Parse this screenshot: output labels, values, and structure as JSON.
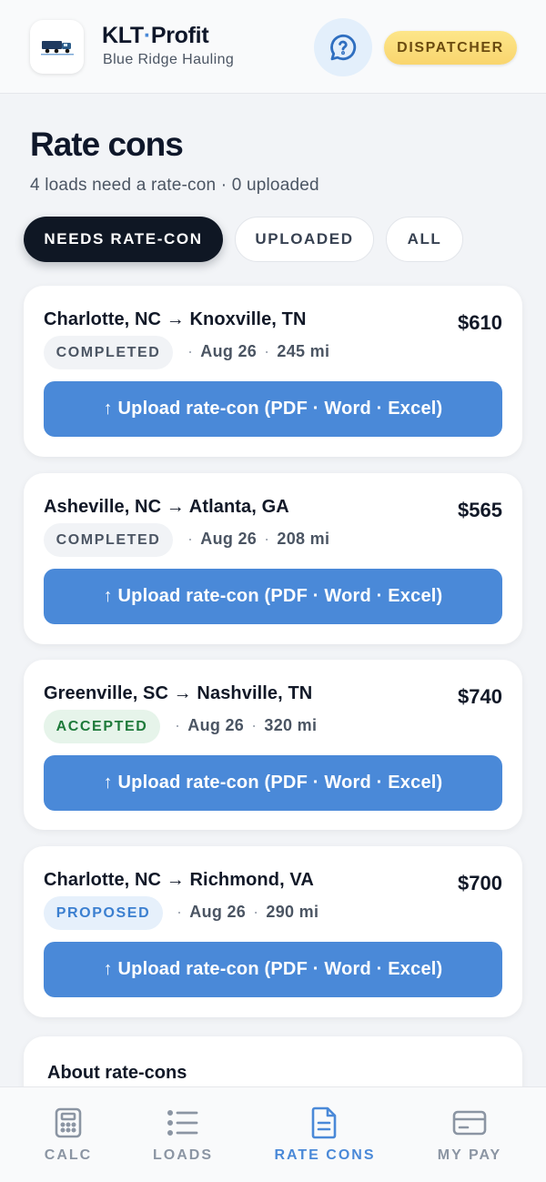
{
  "header": {
    "app_title": "KLT·Profit",
    "app_title_main": "KLT",
    "app_title_dot": "·",
    "app_title_rest": "Profit",
    "company": "Blue Ridge Hauling",
    "role_badge": "DISPATCHER",
    "logo_icon": "truck-logo-icon",
    "help_icon": "help-chat-icon"
  },
  "page": {
    "title": "Rate cons",
    "summary": "4 loads need a rate-con · 0 uploaded"
  },
  "filters": [
    {
      "label": "NEEDS RATE-CON",
      "active": true
    },
    {
      "label": "UPLOADED",
      "active": false
    },
    {
      "label": "ALL",
      "active": false
    }
  ],
  "loads": [
    {
      "route": "Charlotte, NC → Knoxville, TN",
      "price": "$610",
      "status": "COMPLETED",
      "date": "Aug 26",
      "miles": "245 mi",
      "upload_label": "↑ Upload rate-con (PDF · Word · Excel)"
    },
    {
      "route": "Asheville, NC → Atlanta, GA",
      "price": "$565",
      "status": "COMPLETED",
      "date": "Aug 26",
      "miles": "208 mi",
      "upload_label": "↑ Upload rate-con (PDF · Word · Excel)"
    },
    {
      "route": "Greenville, SC → Nashville, TN",
      "price": "$740",
      "status": "ACCEPTED",
      "date": "Aug 26",
      "miles": "320 mi",
      "upload_label": "↑ Upload rate-con (PDF · Word · Excel)"
    },
    {
      "route": "Charlotte, NC → Richmond, VA",
      "price": "$700",
      "status": "PROPOSED",
      "date": "Aug 26",
      "miles": "290 mi",
      "upload_label": "↑ Upload rate-con (PDF · Word · Excel)"
    }
  ],
  "about": {
    "title": "About rate-cons"
  },
  "nav": [
    {
      "label": "CALC",
      "icon": "calculator-icon",
      "active": false
    },
    {
      "label": "LOADS",
      "icon": "list-icon",
      "active": false
    },
    {
      "label": "RATE CONS",
      "icon": "document-icon",
      "active": true
    },
    {
      "label": "MY PAY",
      "icon": "credit-card-icon",
      "active": false
    }
  ],
  "colors": {
    "accent": "#4a89d8",
    "dark": "#0f1724",
    "badge_yellow": "#fde68a",
    "accepted_green": "#1e7a3a",
    "proposed_blue": "#3b7fd0"
  }
}
